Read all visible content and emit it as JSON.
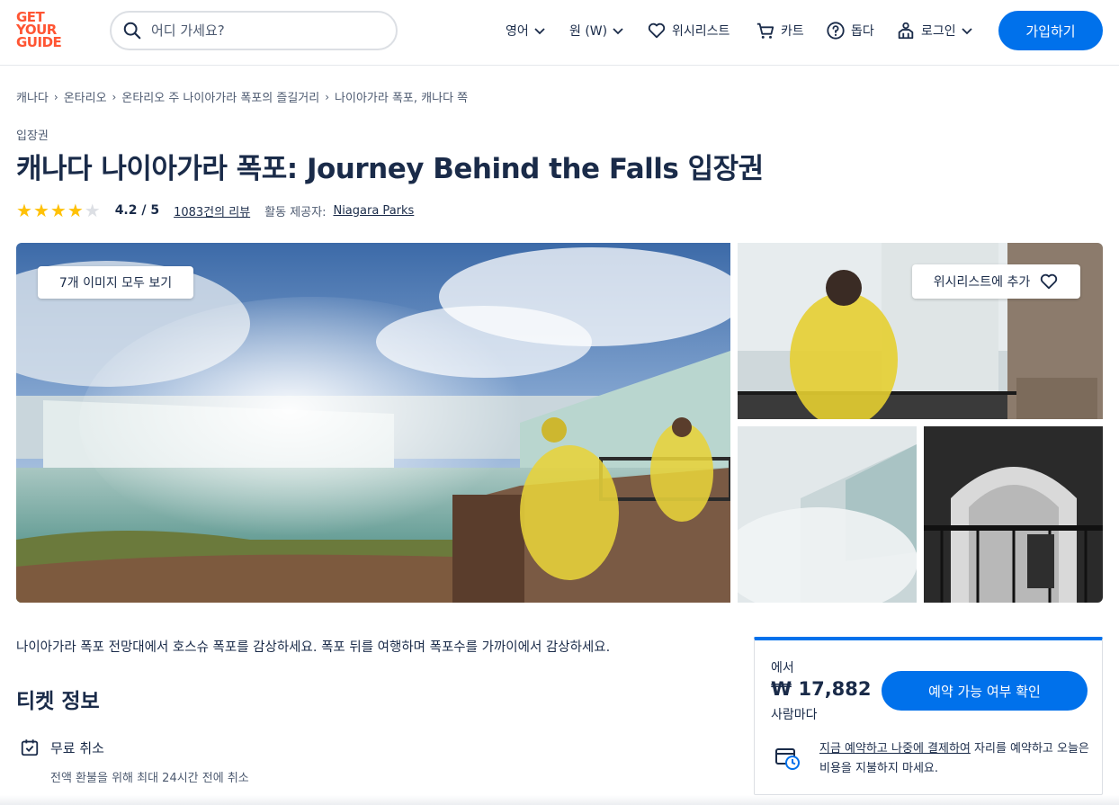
{
  "header": {
    "logo_lines": [
      "GET",
      "YOUR",
      "GUIDE"
    ],
    "search_placeholder": "어디 가세요?",
    "language": "영어",
    "currency": "원 (W)",
    "wishlist": "위시리스트",
    "cart": "카트",
    "help": "돕다",
    "login": "로그인",
    "signup": "가입하기"
  },
  "breadcrumb": [
    "캐나다",
    "온타리오",
    "온타리오 주 나이아가라 폭포의 즐길거리",
    "나이아가라 폭포, 캐나다 쪽"
  ],
  "product": {
    "category": "입장권",
    "title": "캐나다 나이아가라 폭포: Journey Behind the Falls 입장권",
    "rating_value": 4.2,
    "rating_text": "4.2 / 5",
    "reviews": "1083건의 리뷰",
    "provider_label": "활동 제공자:",
    "provider": "Niagara Parks"
  },
  "gallery": {
    "view_all": "7개 이미지 모두 보기",
    "add_wishlist": "위시리스트에 추가"
  },
  "description": "나이아가라 폭포 전망대에서 호스슈 폭포를 감상하세요. 폭포 뒤를 여행하며 폭포수를 가까이에서 감상하세요.",
  "ticket_info": {
    "heading": "티켓 정보",
    "features": [
      {
        "title": "무료 취소",
        "subtitle": "전액 환불을 위해 최대 24시간 전에 취소"
      }
    ]
  },
  "booking": {
    "from": "에서",
    "price": "₩ 17,882",
    "per_person": "사람마다",
    "check_button": "예약 가능 여부 확인",
    "rnpl_link": "지금 예약하고 나중에 결제하여",
    "rnpl_text": " 자리를 예약하고 오늘은 비용을 지불하지 마세요."
  },
  "colors": {
    "brand": "#ff5533",
    "primary": "#0071eb",
    "text": "#1a2b49",
    "star": "#ffc107"
  },
  "icons": [
    "search-icon",
    "chevron-down-icon",
    "heart-icon",
    "cart-icon",
    "help-icon",
    "login-icon",
    "calendar-check-icon",
    "card-clock-icon"
  ]
}
